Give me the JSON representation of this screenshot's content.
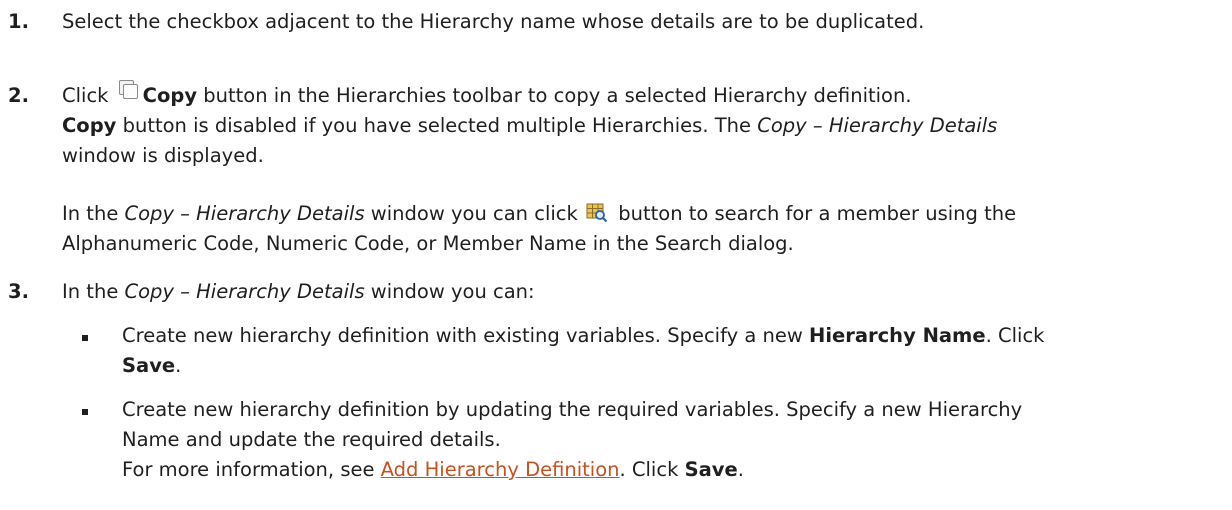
{
  "steps": [
    {
      "num": "1.",
      "text": "Select the checkbox adjacent to the Hierarchy name whose details are to be duplicated."
    },
    {
      "num": "2.",
      "l1_a": "Click",
      "l1_b": "Copy",
      "l1_c": " button in the Hierarchies toolbar to copy a selected Hierarchy definition.",
      "l2_a": "Copy",
      "l2_b": " button is disabled if you have selected multiple Hierarchies. The ",
      "l2_c": "Copy – Hierarchy Details",
      "l3": "window is displayed.",
      "p2_a": "In the ",
      "p2_b": "Copy – Hierarchy Details",
      "p2_c": " window you can click",
      "p2_d": "button to search for a member using the",
      "p2_e": "Alphanumeric Code, Numeric Code, or Member Name in the Search dialog."
    },
    {
      "num": "3.",
      "a": "In the ",
      "b": "Copy – Hierarchy Details",
      "c": " window you can:",
      "bullets": [
        {
          "l1_a": "Create new hierarchy definition with existing variables. Specify a new ",
          "l1_b": "Hierarchy Name",
          "l1_c": ". Click",
          "l2_a": "Save",
          "l2_b": "."
        },
        {
          "l1": "Create new hierarchy definition by updating the required variables. Specify a new Hierarchy",
          "l2": "Name and update the required details.",
          "l3_a": "For more information, see ",
          "l3_link": "Add Hierarchy Definition",
          "l3_b": ". Click ",
          "l3_c": "Save",
          "l3_d": "."
        }
      ]
    }
  ],
  "icons": {
    "copy": "copy-icon",
    "search": "member-search-icon"
  },
  "colors": {
    "link": "#c7511f",
    "text": "#1f1f1f"
  }
}
